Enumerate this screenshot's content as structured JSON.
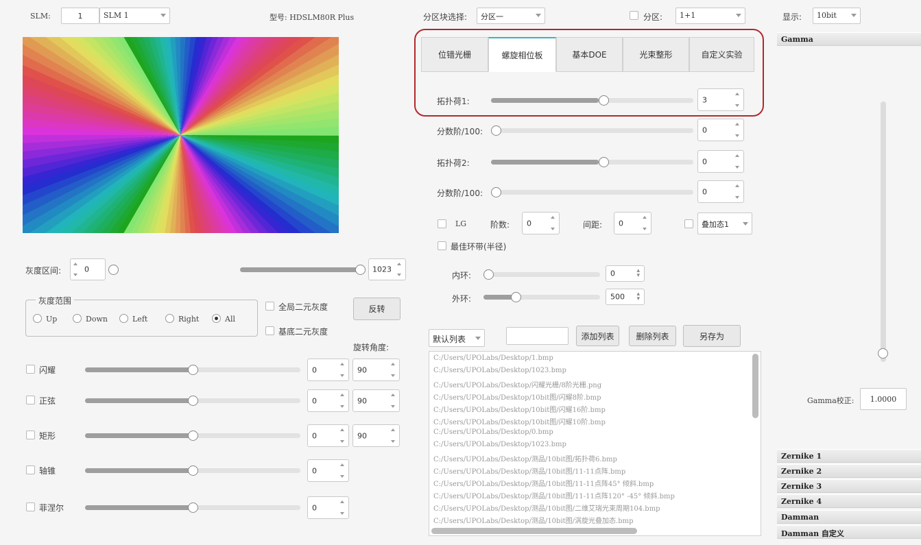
{
  "slm": {
    "label": "SLM:",
    "index": "1",
    "device": "SLM 1",
    "model": "型号: HDSLM80R Plus"
  },
  "partition": {
    "select_label": "分区块选择:",
    "select_value": "分区一",
    "checkbox_label": "分区:",
    "layout_value": "1+1"
  },
  "display": {
    "label": "显示:",
    "value": "10bit"
  },
  "tabs": [
    "位错光栅",
    "螺旋相位板",
    "基本DOE",
    "光束整形",
    "自定义实验"
  ],
  "spiral": {
    "charge1": {
      "label": "拓扑荷1:",
      "value": "3",
      "slider": 0.58
    },
    "frac1": {
      "label": "分数阶/100:",
      "value": "0",
      "slider": 0.0
    },
    "charge2": {
      "label": "拓扑荷2:",
      "value": "0",
      "slider": 0.58
    },
    "frac2": {
      "label": "分数阶/100:",
      "value": "0",
      "slider": 0.0
    },
    "lg_label": "LG",
    "order_label": "阶数:",
    "order_value": "0",
    "spacing_label": "间距:",
    "spacing_value": "0",
    "superpos_value": "叠加态1",
    "best_ring": "最佳环带(半径)",
    "inner": {
      "label": "内环:",
      "value": "0",
      "slider": 0.0
    },
    "outer": {
      "label": "外环:",
      "value": "500",
      "slider": 0.25
    }
  },
  "gray": {
    "interval_label": "灰度区间:",
    "low": "0",
    "high": "1023",
    "range_title": "灰度范围",
    "radios": [
      "Up",
      "Down",
      "Left",
      "Right",
      "All"
    ],
    "global_binary": "全局二元灰度",
    "base_binary": "基底二元灰度",
    "invert": "反转",
    "rotation_label": "旋转角度:"
  },
  "effects": [
    {
      "label": "闪耀",
      "value": "0",
      "angle": "90"
    },
    {
      "label": "正弦",
      "value": "0",
      "angle": "90"
    },
    {
      "label": "矩形",
      "value": "0",
      "angle": "90"
    },
    {
      "label": "轴锥",
      "value": "0",
      "angle": ""
    },
    {
      "label": "菲涅尔",
      "value": "0",
      "angle": ""
    }
  ],
  "list": {
    "select": "默认列表",
    "add": "添加列表",
    "delete": "删除列表",
    "save_as": "另存为",
    "files": [
      "C:/Users/UPOLabs/Desktop/1.bmp",
      "C:/Users/UPOLabs/Desktop/1023.bmp",
      "C:/Users/UPOLabs/Desktop/闪耀光栅/8阶光栅.png",
      "C:/Users/UPOLabs/Desktop/10bit图/闪耀8阶.bmp",
      "C:/Users/UPOLabs/Desktop/10bit图/闪耀16阶.bmp",
      "C:/Users/UPOLabs/Desktop/10bit图/闪耀10阶.bmp",
      "C:/Users/UPOLabs/Desktop/0.bmp",
      "C:/Users/UPOLabs/Desktop/1023.bmp",
      "C:/Users/UPOLabs/Desktop/测品/10bit图/拓扑荷6.bmp",
      "C:/Users/UPOLabs/Desktop/测品/10bit图/11-11点阵.bmp",
      "C:/Users/UPOLabs/Desktop/测品/10bit图/11-11点阵45° 倾斜.bmp",
      "C:/Users/UPOLabs/Desktop/测品/10bit图/11-11点阵120° -45° 倾斜.bmp",
      "C:/Users/UPOLabs/Desktop/测品/10bit图/二维艾瑞光束周期104.bmp",
      "C:/Users/UPOLabs/Desktop/测品/10bit图/涡旋光叠加态.bmp"
    ]
  },
  "gamma": {
    "title": "Gamma",
    "correction_label": "Gamma校正:",
    "correction_value": "1.0000",
    "slider": 0.0
  },
  "sections": [
    "Zernike 1",
    "Zernike 2",
    "Zernike 3",
    "Zernike 4",
    "Damman",
    "Damman 自定义"
  ]
}
